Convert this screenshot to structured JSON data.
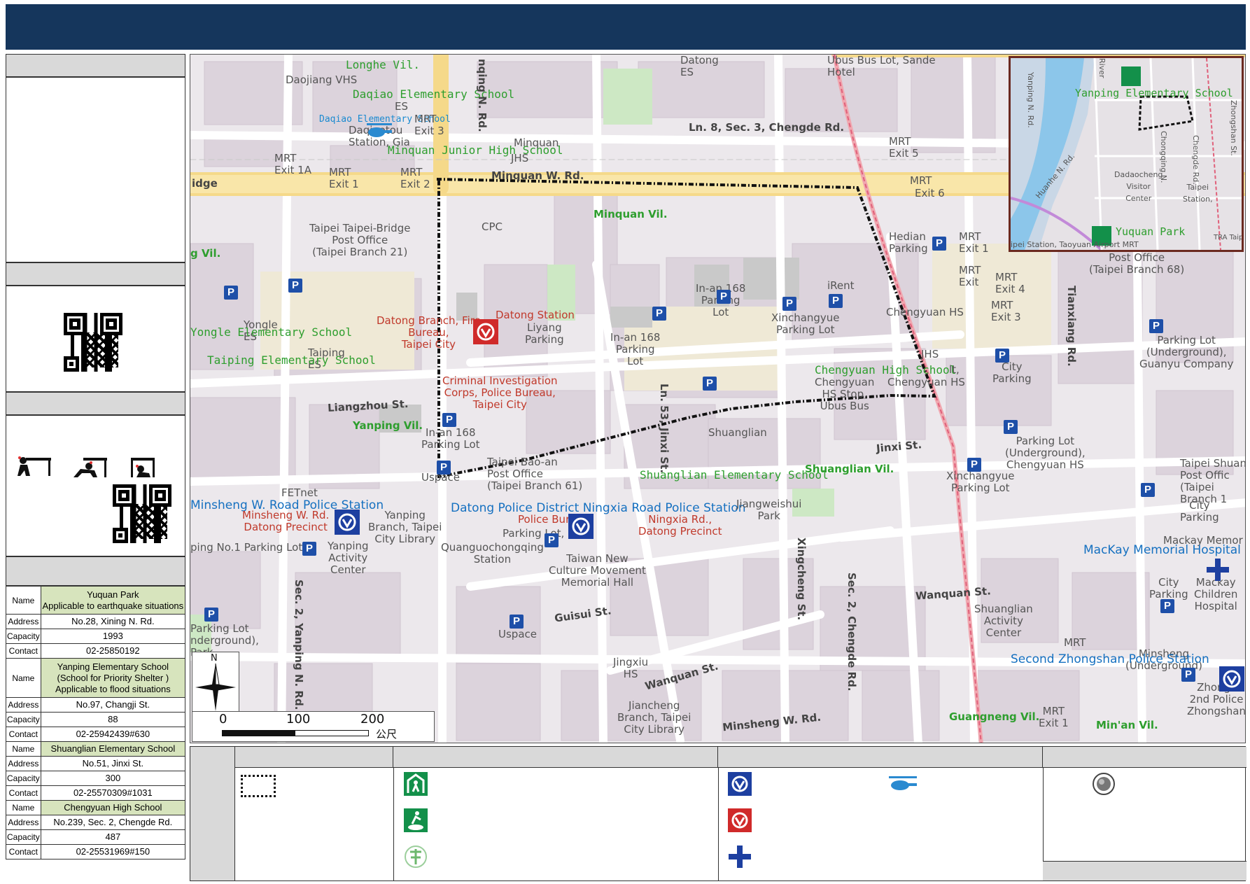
{
  "shelters": [
    {
      "name_label": "Name",
      "name": "Yuquan Park\nApplicable to earthquake situations",
      "address_label": "Address",
      "address": "No.28, Xining N. Rd.",
      "capacity_label": "Capacity",
      "capacity": "1993",
      "contact_label": "Contact",
      "contact": "02-25850192"
    },
    {
      "name_label": "Name",
      "name": "Yanping Elementary School\n(School for Priority Shelter )\nApplicable to flood situations",
      "address_label": "Address",
      "address": "No.97, Changji St.",
      "capacity_label": "Capacity",
      "capacity": "88",
      "contact_label": "Contact",
      "contact": "02-25942439#630"
    },
    {
      "name_label": "Name",
      "name": "Shuanglian Elementary School",
      "address_label": "Address",
      "address": "No.51, Jinxi St.",
      "capacity_label": "Capacity",
      "capacity": "300",
      "contact_label": "Contact",
      "contact": "02-25570309#1031"
    },
    {
      "name_label": "Name",
      "name": "Chengyuan High School",
      "address_label": "Address",
      "address": "No.239, Sec. 2, Chengde Rd.",
      "capacity_label": "Capacity",
      "capacity": "487",
      "contact_label": "Contact",
      "contact": "02-25531969#150"
    }
  ],
  "map_labels": {
    "longhe": "Longhe Vil.",
    "daojiang": "Daojiang VHS",
    "daqiao_es": "Daqiao Elementary School",
    "es": "ES",
    "daqiao_es_small": "Daqiao Elementary School",
    "mrt_exit3": "MRT\nExit 3",
    "daqiaotou": "Daqiaotou\nStation, Gia",
    "minquan_jhs": "Minquan Junior High School",
    "jhs": "JHS",
    "minquan_label": "Minquan",
    "mrt_exit1a": "MRT\nExit 1A",
    "mrt_exit1": "MRT\nExit 1",
    "mrt_exit2": "MRT\nExit 2",
    "minquan_rd": "Minquan W. Rd.",
    "bridge": "idge",
    "datong_es": "Datong\nES",
    "ubus": "Ubus Bus Lot, Sande\nHotel",
    "chengde_ln": "Ln. 8, Sec. 3, Chengde Rd.",
    "mrt_exit5": "MRT\nExit 5",
    "taipei_bridge_po": "Taipei Taipei-Bridge\nPost Office\n(Taipei Branch 21)",
    "cpc": "CPC",
    "minquan_vil": "Minquan Vil.",
    "g_vil": "g Vil.",
    "hedian": "Hedian\nParking",
    "mrt_exit1b": "MRT\nExit 1",
    "mrt_exit_r": "MRT\nExit",
    "mrt_exit4": "MRT\nExit 4",
    "mrt_exit3b": "MRT\nExit 3",
    "mrt_exit6": "Exit 6",
    "mrt_top": "MRT",
    "post_office_68": "Post Office\n(Taipei Branch 68)",
    "tianxiang": "Tianxiang Rd.",
    "parking_lot_guanyu": "Parking Lot\n(Underground),\nGuanyu Company",
    "yongle": "Yongle\nES",
    "yongle_es": "Yongle Elementary School",
    "taiping": "Taiping\nES",
    "taiping_es": "Taiping Elementary School",
    "datong_branch": "Datong Branch, Fire\nBureau,\nTaipei City",
    "datong_station": "Datong Station",
    "liyang": "Liyang\nParking",
    "inan168_a": "In-an 168\nParking\nLot",
    "xinchangyue": "Xinchangyue\nParking Lot",
    "irent": "iRent",
    "inan168_b": "In-an 168\nParking\nLot",
    "chengyuan_hs": "Chengyuan HS",
    "jhs2": "JHS",
    "city_parking": "City\nParking",
    "cib": "Criminal Investigation\nCorps, Police Bureau,\nTaipei City",
    "chengyuan_high": "Chengyuan High School",
    "chengyuan_stop": "Chengyuan\nHS Stop,\nUbus Bus",
    "chengyuan_hs2": "Chengyuan HS",
    "lt": "lt,",
    "liangzhou": "Liangzhou St.",
    "yanping_vil": "Yanping Vil.",
    "inan168_c": "In-an 168\nParking Lot",
    "jinxi_ln": "Ln. 53, Jinxi St.",
    "shuanglian": "Shuanglian",
    "jinxi_st": "Jinxi St.",
    "parking_chengyuan": "Parking Lot\n(Underground),\nChengyuan HS",
    "taipei_shuan": "Taipei Shuan\nPost Offic\n(Taipei\nBranch 1",
    "uspace": "Uspace",
    "baoan": "Taipei Bao-an\nPost Office\n(Taipei Branch 61)",
    "shuanglian_es": "Shuanglian Elementary School",
    "shuanglian_vil": "Shuanglian Vil.",
    "xinchangyue2": "Xinchangyue\nParking Lot",
    "city_parking2": "City\nParking",
    "fetnet": "FETnet",
    "minsheng_ps": "Minsheng W. Road Police Station",
    "minsheng_rd": "Minsheng W. Rd.\nDatong Precinct",
    "yanping_lib": "Yanping\nBranch, Taipei\nCity Library",
    "datong_pd": "Datong Police District Ningxia Road Police Station",
    "police_bureau": "Police Bureau",
    "ningxia": "Ningxia Rd.,\nDatong Precinct",
    "parking_lot_c": "Parking Lot,",
    "jiangweishui": "Jiangweishui\nPark",
    "mackay_mem": "Mackay Memor",
    "mackay": "MacKay Memorial Hospital",
    "no1_parking": "ping No.1 Parking Lot",
    "yanping_ac": "Yanping\nActivity\nCenter",
    "quanguo": "Quanguochongqing\nStation",
    "taiwan_new": "Taiwan New\nCulture Movement\nMemorial Hall",
    "xingcheng": "Xingcheng St.",
    "chengde_rd": "Sec. 2, Chengde Rd.",
    "city_parking3": "City\nParking",
    "mackay_child": "Mackay\nChildren\nHospital",
    "wanquan": "Wanquan St.",
    "shuanglian_ac": "Shuanglian\nActivity\nCenter",
    "parking_ug": "Parking Lot\nnderground),\nPark",
    "yanping_rd": "Sec. 2, Yanping N. Rd.",
    "guisui": "Guisui St.",
    "uspace2": "Uspace",
    "jingxiu": "Jingxiu\nHS",
    "wanquan2": "Wanquan St.",
    "mrt_b": "MRT",
    "minsheng_st": "Minsheng\n(Underground)",
    "second_zhongshan": "Second Zhongshan Police Station",
    "zhongs": "Zhongs\n2nd Police\nZhongshan",
    "jiancheng": "Jiancheng\nBranch, Taipei\nCity Library",
    "minsheng_rd2": "Minsheng W. Rd.",
    "guangneng": "Guangneng Vil.",
    "mrt_exit1c": "MRT\nExit 1",
    "minan": "Min'an Vil.",
    "chongqing": "nqing N. Rd."
  },
  "inset": {
    "yanping_es": "Yanping Elementary School",
    "dadaocheng": "Dadaocheng\nVisitor\nCenter",
    "yuquan": "Yuquan Park",
    "taipei_station": "Taipei\nStation,",
    "bottom": "ipei Station, Taoyuan Airport MRT",
    "huanhe": "Huanhe N. Rd.",
    "chengde": "Chengde Rd.",
    "chongqing": "Chongqing N.",
    "yanping": "Yanping N. Rd.",
    "river": "River",
    "zhongshan": "Zhongshan St.",
    "tra": "TRA Taipei"
  },
  "scale": {
    "t0": "0",
    "t100": "100",
    "t200": "200",
    "unit": "公尺"
  },
  "compass": {
    "north": "N"
  },
  "colors": {
    "header": "#15365c",
    "route": "#111111",
    "shelter_green": "#13904a",
    "police_blue": "#1d3fa0",
    "fire_red": "#d02a2a"
  }
}
